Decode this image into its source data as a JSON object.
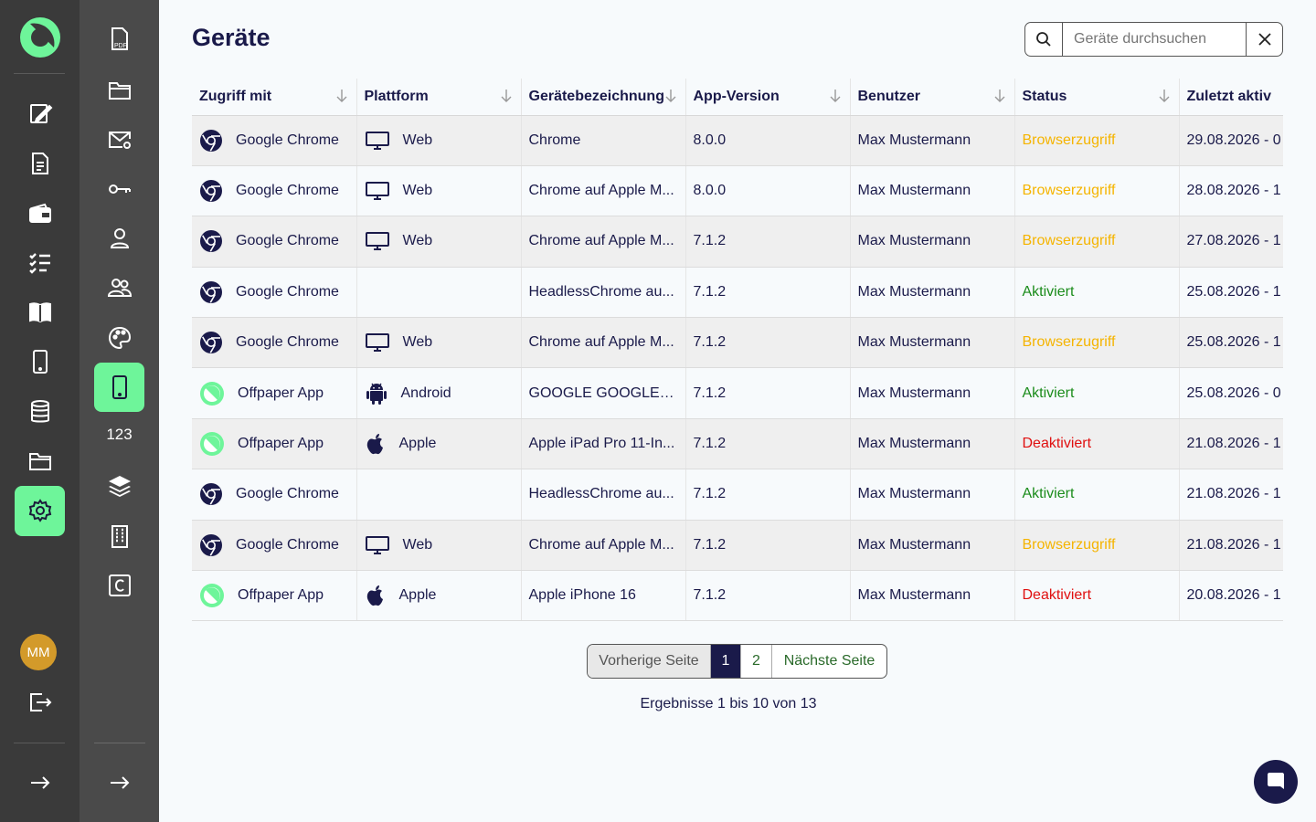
{
  "page": {
    "title": "Geräte"
  },
  "search": {
    "placeholder": "Geräte durchsuchen"
  },
  "sidebar_secondary": {
    "number_label": "123"
  },
  "user": {
    "initials": "MM"
  },
  "table": {
    "headers": [
      "Zugriff mit",
      "Plattform",
      "Gerätebezeichnung",
      "App-Version",
      "Benutzer",
      "Status",
      "Zuletzt aktiv"
    ],
    "rows": [
      {
        "access": "Google Chrome",
        "access_icon": "chrome-icon",
        "platform": "Web",
        "platform_icon": "monitor-icon",
        "device": "Chrome",
        "version": "8.0.0",
        "user": "Max Mustermann",
        "status": "Browserzugriff",
        "status_type": "warn",
        "last_active": "29.08.2026 - 0"
      },
      {
        "access": "Google Chrome",
        "access_icon": "chrome-icon",
        "platform": "Web",
        "platform_icon": "monitor-icon",
        "device": "Chrome auf Apple M...",
        "version": "8.0.0",
        "user": "Max Mustermann",
        "status": "Browserzugriff",
        "status_type": "warn",
        "last_active": "28.08.2026 - 1"
      },
      {
        "access": "Google Chrome",
        "access_icon": "chrome-icon",
        "platform": "Web",
        "platform_icon": "monitor-icon",
        "device": "Chrome auf Apple M...",
        "version": "7.1.2",
        "user": "Max Mustermann",
        "status": "Browserzugriff",
        "status_type": "warn",
        "last_active": "27.08.2026 - 1"
      },
      {
        "access": "Google Chrome",
        "access_icon": "chrome-icon",
        "platform": "",
        "platform_icon": "",
        "device": "HeadlessChrome au...",
        "version": "7.1.2",
        "user": "Max Mustermann",
        "status": "Aktiviert",
        "status_type": "ok",
        "last_active": "25.08.2026 - 1"
      },
      {
        "access": "Google Chrome",
        "access_icon": "chrome-icon",
        "platform": "Web",
        "platform_icon": "monitor-icon",
        "device": "Chrome auf Apple M...",
        "version": "7.1.2",
        "user": "Max Mustermann",
        "status": "Browserzugriff",
        "status_type": "warn",
        "last_active": "25.08.2026 - 1"
      },
      {
        "access": "Offpaper App",
        "access_icon": "offpaper-icon",
        "platform": "Android",
        "platform_icon": "android-icon",
        "device": "GOOGLE GOOGLE s...",
        "version": "7.1.2",
        "user": "Max Mustermann",
        "status": "Aktiviert",
        "status_type": "ok",
        "last_active": "25.08.2026 - 0"
      },
      {
        "access": "Offpaper App",
        "access_icon": "offpaper-icon",
        "platform": "Apple",
        "platform_icon": "apple-icon",
        "device": "Apple iPad Pro 11-In...",
        "version": "7.1.2",
        "user": "Max Mustermann",
        "status": "Deaktiviert",
        "status_type": "off",
        "last_active": "21.08.2026 - 1"
      },
      {
        "access": "Google Chrome",
        "access_icon": "chrome-icon",
        "platform": "",
        "platform_icon": "",
        "device": "HeadlessChrome au...",
        "version": "7.1.2",
        "user": "Max Mustermann",
        "status": "Aktiviert",
        "status_type": "ok",
        "last_active": "21.08.2026 - 1"
      },
      {
        "access": "Google Chrome",
        "access_icon": "chrome-icon",
        "platform": "Web",
        "platform_icon": "monitor-icon",
        "device": "Chrome auf Apple M...",
        "version": "7.1.2",
        "user": "Max Mustermann",
        "status": "Browserzugriff",
        "status_type": "warn",
        "last_active": "21.08.2026 - 1"
      },
      {
        "access": "Offpaper App",
        "access_icon": "offpaper-icon",
        "platform": "Apple",
        "platform_icon": "apple-icon",
        "device": "Apple iPhone 16",
        "version": "7.1.2",
        "user": "Max Mustermann",
        "status": "Deaktiviert",
        "status_type": "off",
        "last_active": "20.08.2026 - 1"
      }
    ]
  },
  "pagination": {
    "prev": "Vorherige Seite",
    "pages": [
      "1",
      "2"
    ],
    "current": "1",
    "next": "Nächste Seite",
    "summary": "Ergebnisse 1 bis 10 von 13"
  },
  "colors": {
    "accent": "#6ef59a",
    "navy": "#1a1a4a",
    "warn": "#f5b400",
    "ok": "#1b8c1b",
    "off": "#e01010"
  }
}
